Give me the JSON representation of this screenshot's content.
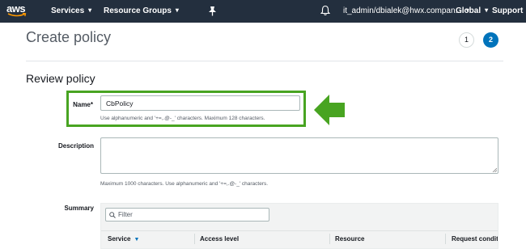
{
  "topnav": {
    "logo": "aws",
    "services": "Services",
    "resource_groups": "Resource Groups",
    "account": "it_admin/dbialek@hwx.compan...",
    "region": "Global",
    "support": "Support"
  },
  "page": {
    "title": "Create policy",
    "steps": [
      "1",
      "2"
    ],
    "section_title": "Review policy"
  },
  "form": {
    "name_label": "Name*",
    "name_value": "CbPolicy",
    "name_hint": "Use alphanumeric and '+=,.@-_' characters. Maximum 128 characters.",
    "description_label": "Description",
    "description_value": "",
    "description_hint": "Maximum 1000 characters. Use alphanumeric and '+=,.@-_' characters.",
    "summary_label": "Summary"
  },
  "summary": {
    "filter_placeholder": "Filter",
    "columns": [
      "Service",
      "Access level",
      "Resource",
      "Request conditi"
    ]
  },
  "colors": {
    "nav_bg": "#232f3e",
    "highlight": "#48a421",
    "accent": "#0073bb"
  }
}
